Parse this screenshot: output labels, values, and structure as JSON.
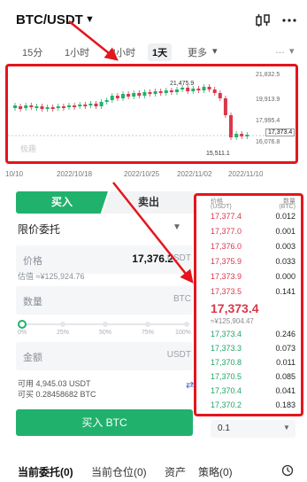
{
  "header": {
    "pair": "BTC/USDT"
  },
  "timeframes": [
    {
      "label": "15分",
      "active": false
    },
    {
      "label": "1小时",
      "active": false
    },
    {
      "label": "4小时",
      "active": false
    },
    {
      "label": "1天",
      "active": true
    },
    {
      "label": "更多",
      "active": false
    }
  ],
  "chart": {
    "price_labels": [
      "21,832.5",
      "19,913.9",
      "17,995.4",
      "17,373.4",
      "16,076.8"
    ],
    "annotations": {
      "high": "21,475.9",
      "low": "15,511.1"
    },
    "watermark": "极趣",
    "x_labels": [
      "10/10",
      "2022/10/18",
      "2022/10/25",
      "2022/11/02",
      "2022/11/10"
    ]
  },
  "form": {
    "buy_tab": "买入",
    "sell_tab": "卖出",
    "order_type": "限价委托",
    "price_label": "价格",
    "price_value": "17,376.2",
    "price_unit": "USDT",
    "price_fiat_hint": "估值 ≈¥125,924.76",
    "qty_label": "数量",
    "qty_unit": "BTC",
    "slider_marks": [
      "0%",
      "25%",
      "50%",
      "75%",
      "100%"
    ],
    "amount_label": "金额",
    "amount_unit": "USDT",
    "available": "可用 4,945.03 USDT",
    "can_buy": "可买 0.28458682 BTC",
    "buy_button": "买入 BTC"
  },
  "orderbook": {
    "col_price": "价格",
    "col_price_unit": "(USDT)",
    "col_qty": "数量",
    "col_qty_unit": "(BTC)",
    "asks": [
      {
        "price": "17,377.4",
        "qty": "0.012"
      },
      {
        "price": "17,377.0",
        "qty": "0.001"
      },
      {
        "price": "17,376.0",
        "qty": "0.003"
      },
      {
        "price": "17,375.9",
        "qty": "0.033"
      },
      {
        "price": "17,373.9",
        "qty": "0.000"
      },
      {
        "price": "17,373.5",
        "qty": "0.141"
      }
    ],
    "mid_price": "17,373.4",
    "mid_fiat": "≈¥125,904.47",
    "bids": [
      {
        "price": "17,373.4",
        "qty": "0.246"
      },
      {
        "price": "17,373.3",
        "qty": "0.073"
      },
      {
        "price": "17,370.8",
        "qty": "0.011"
      },
      {
        "price": "17,370.5",
        "qty": "0.085"
      },
      {
        "price": "17,370.4",
        "qty": "0.041"
      },
      {
        "price": "17,370.2",
        "qty": "0.183"
      }
    ],
    "depth": "0.1"
  },
  "bottom_tabs": [
    "当前委托(0)",
    "当前仓位(0)",
    "资产",
    "策略(0)"
  ],
  "colors": {
    "buy": "#20b26c",
    "sell": "#d9374a",
    "highlight": "#e5151c"
  }
}
